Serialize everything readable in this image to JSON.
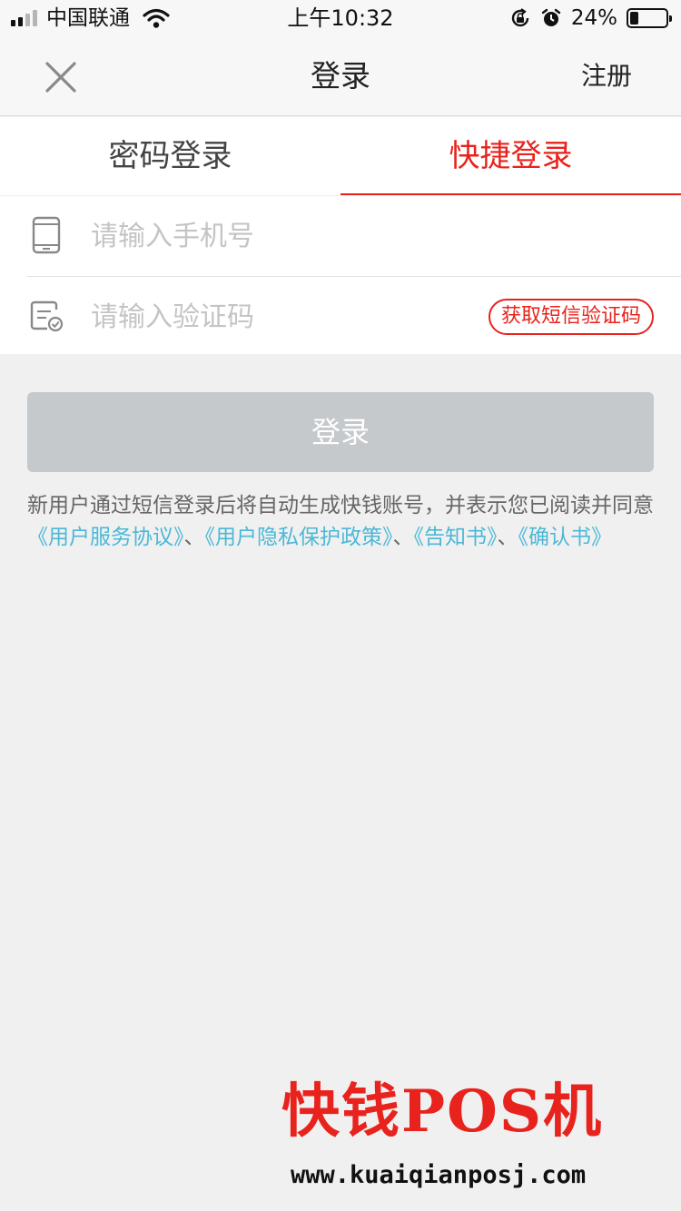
{
  "status_bar": {
    "carrier": "中国联通",
    "time": "上午10:32",
    "battery_pct": "24%",
    "battery_level": 0.24,
    "icons": [
      "signal-icon",
      "wifi-icon",
      "orientation-lock-icon",
      "alarm-icon",
      "battery-icon"
    ]
  },
  "nav": {
    "title": "登录",
    "register": "注册",
    "close_icon": "close-icon"
  },
  "tabs": [
    {
      "label": "密码登录",
      "active": false
    },
    {
      "label": "快捷登录",
      "active": true
    }
  ],
  "form": {
    "phone": {
      "placeholder": "请输入手机号",
      "value": "",
      "icon": "phone-icon"
    },
    "code": {
      "placeholder": "请输入验证码",
      "value": "",
      "icon": "verify-code-icon"
    },
    "sms_button": "获取短信验证码"
  },
  "login_button": "登录",
  "agreement": {
    "text1": "新用户通过短信登录后将自动生成快钱账号，并表示您已阅读并同意",
    "link1": "《用户服务协议》",
    "sep1": "、",
    "link2": "《用户隐私保护政策》",
    "sep2": "、",
    "link3": "《告知书》",
    "sep3": "、",
    "link4": "《确认书》"
  },
  "watermark": {
    "brand": "快钱POS机",
    "url": "www.kuaiqianposj.com"
  },
  "colors": {
    "accent": "#e8231d",
    "link": "#4bb8d6",
    "disabled_button": "#c5c9cc",
    "background": "#f0f0f0"
  }
}
